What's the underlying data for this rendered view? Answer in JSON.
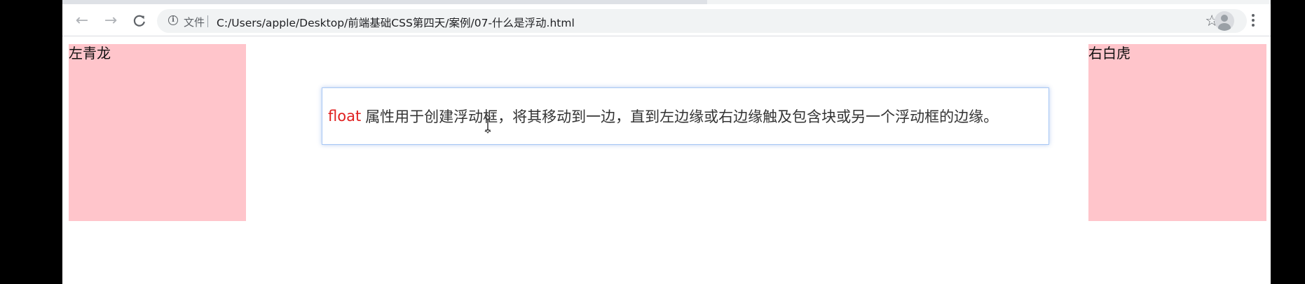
{
  "browser": {
    "security_label": "文件",
    "url": "C:/Users/apple/Desktop/前端基础CSS第四天/案例/07-什么是浮动.html",
    "icons": {
      "back": "arrow-left-icon",
      "forward": "arrow-right-icon",
      "reload": "reload-icon",
      "info": "info-icon",
      "star": "star-icon",
      "profile": "profile-icon",
      "menu": "kebab-menu-icon"
    }
  },
  "page": {
    "left_box_label": "左青龙",
    "right_box_label": "右白虎",
    "box_color": "#ffc5cb",
    "tooltip": {
      "keyword": "float",
      "text": "属性用于创建浮动框，将其移动到一边，直到左边缘或右边缘触及包含块或另一个浮动框的边缘。",
      "keyword_color": "#e02020"
    }
  }
}
